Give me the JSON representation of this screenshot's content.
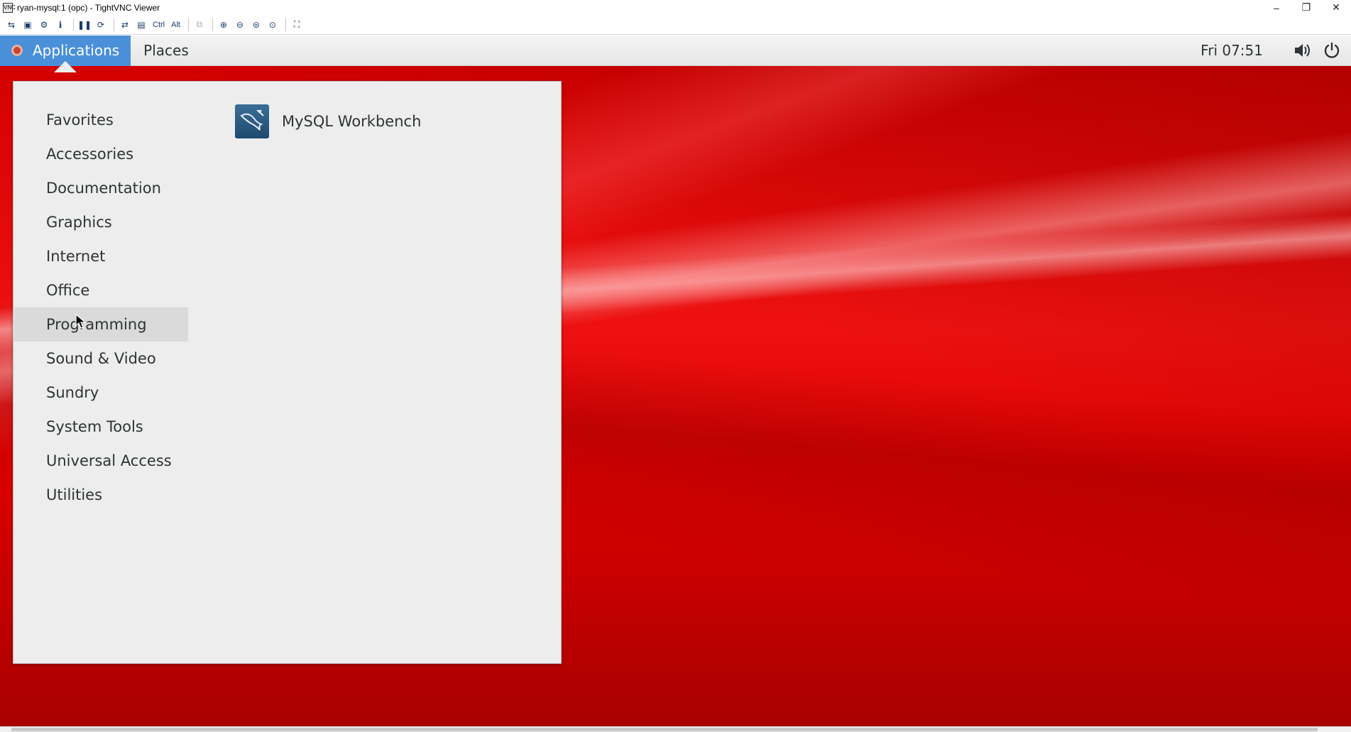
{
  "window": {
    "title": "ryan-mysql:1 (opc) - TightVNC Viewer",
    "app_icon_text": "VNC",
    "controls": {
      "minimize": "–",
      "restore": "❐",
      "close": "✕"
    }
  },
  "toolbar": {
    "buttons": [
      "new-connection-icon",
      "save-icon",
      "options-icon",
      "info-icon",
      "pause-icon",
      "refresh-icon",
      "transfer-icon",
      "ctrl-alt-del-icon"
    ],
    "ctrl_label": "Ctrl",
    "alt_label": "Alt",
    "zoom_buttons": [
      "zoom-in-icon",
      "zoom-out-icon",
      "zoom-100-icon",
      "zoom-fit-icon"
    ]
  },
  "topbar": {
    "applications_label": "Applications",
    "places_label": "Places",
    "clock": "Fri 07:51",
    "accent_color": "#4a90d9"
  },
  "menu": {
    "categories": [
      {
        "label": "Favorites"
      },
      {
        "label": "Accessories"
      },
      {
        "label": "Documentation"
      },
      {
        "label": "Graphics"
      },
      {
        "label": "Internet"
      },
      {
        "label": "Office"
      },
      {
        "label": "Programming",
        "hover": true
      },
      {
        "label": "Sound & Video"
      },
      {
        "label": "Sundry"
      },
      {
        "label": "System Tools"
      },
      {
        "label": "Universal Access"
      },
      {
        "label": "Utilities"
      }
    ],
    "apps": [
      {
        "label": "MySQL Workbench",
        "icon": "mysql-workbench-icon"
      }
    ]
  },
  "desktop": {
    "background_color": "#e00000"
  }
}
